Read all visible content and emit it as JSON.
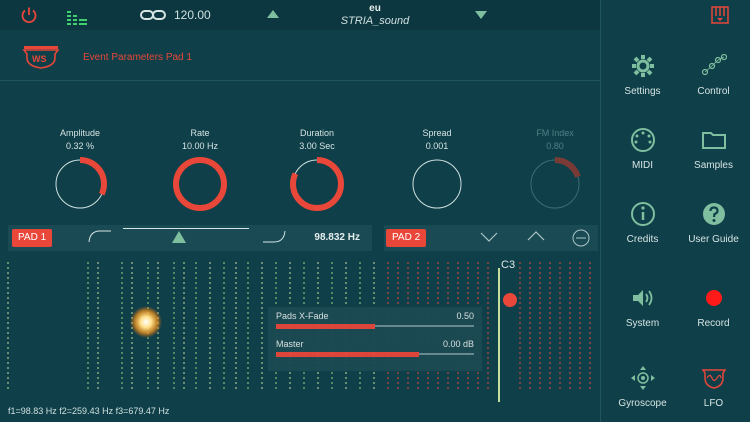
{
  "topbar": {
    "tempo": "120.00",
    "preset_bank": "eu",
    "preset_name": "STRIA_sound"
  },
  "header": {
    "logo_text": "WS",
    "title": "Event Parameters Pad 1"
  },
  "knobs": [
    {
      "label": "Amplitude",
      "value": "0.32 %",
      "level": 0.32,
      "enabled": true
    },
    {
      "label": "Rate",
      "value": "10.00 Hz",
      "level": 1.0,
      "enabled": true
    },
    {
      "label": "Duration",
      "value": "3.00 Sec",
      "level": 0.82,
      "enabled": true
    },
    {
      "label": "Spread",
      "value": "0.001",
      "level": 0.0,
      "enabled": true
    },
    {
      "label": "FM Index",
      "value": "0.80",
      "level": 0.2,
      "enabled": false
    }
  ],
  "pad1": {
    "label": "PAD 1",
    "frequency": "98.832 Hz"
  },
  "pad2": {
    "label": "PAD 2"
  },
  "mixer": {
    "crossfade_label": "Pads X-Fade",
    "crossfade_value": "0.50",
    "crossfade_level": 0.5,
    "master_label": "Master",
    "master_value": "0.00 dB",
    "master_level": 0.72
  },
  "note_label": "C3",
  "frequency_readout": "f1=98.83 Hz f2=259.43 Hz f3=679.47 Hz",
  "side_panel": {
    "items": [
      {
        "label": "Settings",
        "icon": "gear-icon"
      },
      {
        "label": "Control",
        "icon": "control-icon"
      },
      {
        "label": "MIDI",
        "icon": "midi-icon"
      },
      {
        "label": "Samples",
        "icon": "folder-icon"
      },
      {
        "label": "Credits",
        "icon": "info-icon"
      },
      {
        "label": "User Guide",
        "icon": "help-icon"
      },
      {
        "label": "System",
        "icon": "speaker-icon"
      },
      {
        "label": "Record",
        "icon": "record-icon"
      },
      {
        "label": "Gyroscope",
        "icon": "gyroscope-icon"
      },
      {
        "label": "LFO",
        "icon": "lfo-icon"
      }
    ]
  },
  "colors": {
    "accent": "#e8473a",
    "background": "#0f3f48",
    "green": "#7fbf9f",
    "yellow_green": "#c4df9b"
  }
}
